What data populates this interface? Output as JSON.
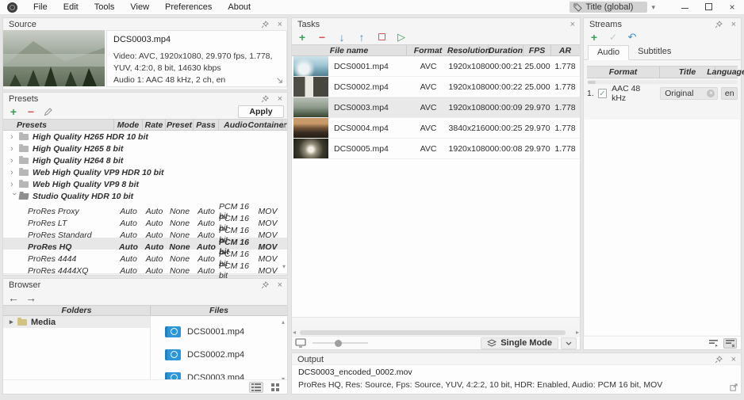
{
  "menubar": {
    "items": [
      "File",
      "Edit",
      "Tools",
      "View",
      "Preferences",
      "About"
    ],
    "title_field": "Title  (global)"
  },
  "source": {
    "title": "Source",
    "file_name": "DCS0003.mp4",
    "video_info": "Video: AVC, 1920x1080, 29.970 fps, 1.778, YUV, 4:2:0, 8 bit, 14630 kbps",
    "audio_info": "Audio 1: AAC  48 kHz, 2 ch, en"
  },
  "presets": {
    "title": "Presets",
    "apply_label": "Apply",
    "columns": [
      "Presets",
      "Mode",
      "Rate",
      "Preset",
      "Pass",
      "Audio",
      "Container"
    ],
    "groups": [
      {
        "name": "High Quality H265 HDR 10 bit"
      },
      {
        "name": "High Quality H265 8 bit"
      },
      {
        "name": "High Quality H264 8 bit"
      },
      {
        "name": "Web High Quality VP9 HDR 10 bit"
      },
      {
        "name": "Web High Quality VP9 8 bit"
      },
      {
        "name": "Studio Quality HDR 10 bit"
      }
    ],
    "children": [
      {
        "name": "ProRes Proxy",
        "mode": "Auto",
        "rate": "Auto",
        "preset": "None",
        "pass": "Auto",
        "audio": "PCM 16 bit",
        "container": "MOV"
      },
      {
        "name": "ProRes LT",
        "mode": "Auto",
        "rate": "Auto",
        "preset": "None",
        "pass": "Auto",
        "audio": "PCM 16 bit",
        "container": "MOV"
      },
      {
        "name": "ProRes Standard",
        "mode": "Auto",
        "rate": "Auto",
        "preset": "None",
        "pass": "Auto",
        "audio": "PCM 16 bit",
        "container": "MOV"
      },
      {
        "name": "ProRes HQ",
        "mode": "Auto",
        "rate": "Auto",
        "preset": "None",
        "pass": "Auto",
        "audio": "PCM 16 bit",
        "container": "MOV"
      },
      {
        "name": "ProRes 4444",
        "mode": "Auto",
        "rate": "Auto",
        "preset": "None",
        "pass": "Auto",
        "audio": "PCM 16 bit",
        "container": "MOV"
      },
      {
        "name": "ProRes 4444XQ",
        "mode": "Auto",
        "rate": "Auto",
        "preset": "None",
        "pass": "Auto",
        "audio": "PCM 16 bit",
        "container": "MOV"
      }
    ]
  },
  "browser": {
    "title": "Browser",
    "columns": [
      "Folders",
      "Files"
    ],
    "folders": [
      "Media"
    ],
    "files": [
      "DCS0001.mp4",
      "DCS0002.mp4",
      "DCS0003.mp4"
    ]
  },
  "tasks": {
    "title": "Tasks",
    "columns": [
      "File name",
      "Format",
      "Resolution",
      "Duration",
      "FPS",
      "AR"
    ],
    "rows": [
      {
        "file": "DCS0001.mp4",
        "format": "AVC",
        "resolution": "1920x1080",
        "duration": "00:00:21",
        "fps": "25.000",
        "ar": "1.778"
      },
      {
        "file": "DCS0002.mp4",
        "format": "AVC",
        "resolution": "1920x1080",
        "duration": "00:00:22",
        "fps": "25.000",
        "ar": "1.778"
      },
      {
        "file": "DCS0003.mp4",
        "format": "AVC",
        "resolution": "1920x1080",
        "duration": "00:00:09",
        "fps": "29.970",
        "ar": "1.778"
      },
      {
        "file": "DCS0004.mp4",
        "format": "AVC",
        "resolution": "3840x2160",
        "duration": "00:00:25",
        "fps": "29.970",
        "ar": "1.778"
      },
      {
        "file": "DCS0005.mp4",
        "format": "AVC",
        "resolution": "1920x1080",
        "duration": "00:00:08",
        "fps": "29.970",
        "ar": "1.778"
      }
    ],
    "mode_button": "Single Mode"
  },
  "streams": {
    "title": "Streams",
    "tabs": [
      "Audio",
      "Subtitles"
    ],
    "columns": [
      "Format",
      "Title",
      "Language"
    ],
    "rows": [
      {
        "index": "1.",
        "checked": true,
        "format": "AAC  48 kHz",
        "stream_title": "Original",
        "language": "en"
      }
    ]
  },
  "output": {
    "title": "Output",
    "file_name": "DCS0003_encoded_0002.mov",
    "description": "ProRes HQ, Res: Source, Fps: Source, YUV, 4:2:2, 10 bit, HDR: Enabled, Audio: PCM 16 bit, MOV"
  },
  "icons": {
    "add": "+",
    "remove": "−",
    "move_down": "↓",
    "move_up": "↑",
    "play": "▷",
    "undo": "↶",
    "check": "✓",
    "back": "←",
    "forward": "→",
    "close": "×",
    "chevron": "›",
    "tree_arrow": "▸",
    "scroll_up": "▴",
    "scroll_down": "▾",
    "scroll_left": "◂",
    "scroll_right": "▸",
    "dropdown": "▾",
    "chevron_down": "∨"
  },
  "colors": {
    "accent_green": "#3a9e57",
    "accent_red": "#d95555",
    "accent_blue": "#3f8fce",
    "file_icon_blue": "#2b96d9"
  }
}
